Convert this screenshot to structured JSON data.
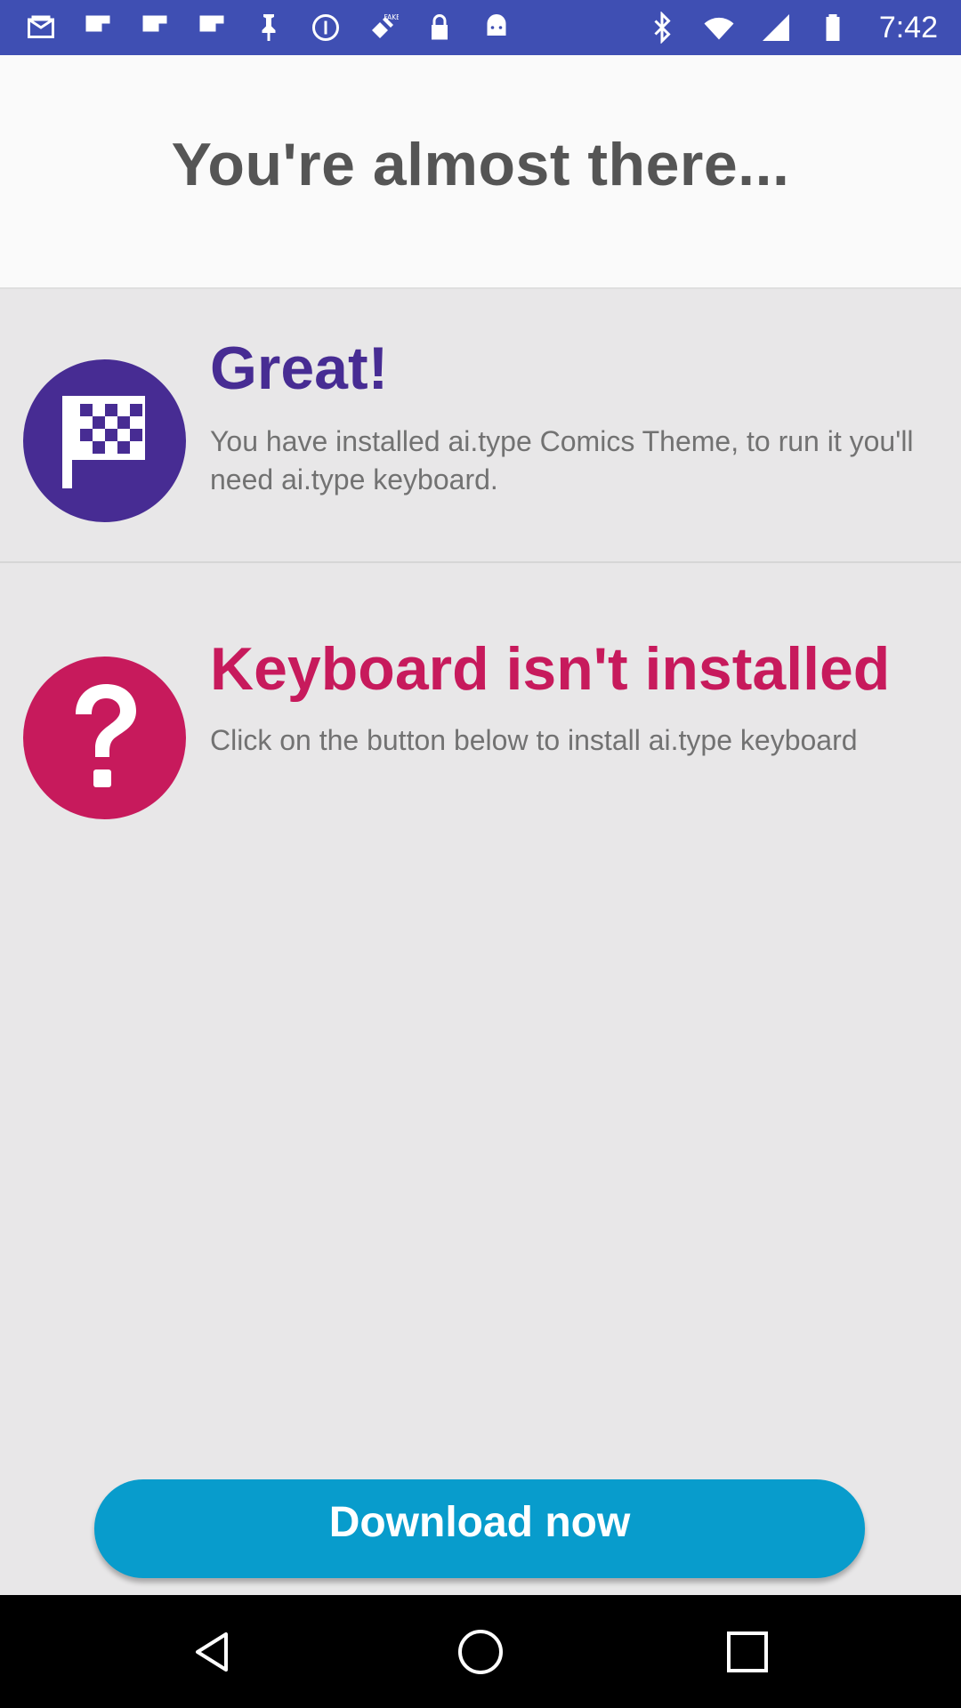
{
  "status_bar": {
    "time": "7:42",
    "left_icons": [
      "email-icon",
      "flipboard-icon",
      "flipboard-icon",
      "flipboard-icon",
      "pin-icon",
      "info-circle-icon",
      "fake-gps-icon",
      "lock-icon",
      "android-icon"
    ],
    "right_icons": [
      "bluetooth-icon",
      "wifi-icon",
      "signal-icon",
      "battery-icon"
    ],
    "background": "#3f4fb3"
  },
  "header": {
    "title": "You're almost there..."
  },
  "great_section": {
    "icon": "checkered-flag-icon",
    "title": "Great!",
    "description": "You have installed ai.type Comics Theme, to run it you'll need ai.type keyboard.",
    "accent_color": "#472c93"
  },
  "keyboard_section": {
    "icon": "question-mark-icon",
    "title": "Keyboard isn't installed",
    "description": "Click on the button below to install ai.type keyboard",
    "accent_color": "#c71a5c"
  },
  "download_button": {
    "label": "Download now",
    "color": "#089ccc"
  },
  "nav_bar": {
    "buttons": [
      "back-icon",
      "home-icon",
      "recents-icon"
    ]
  }
}
